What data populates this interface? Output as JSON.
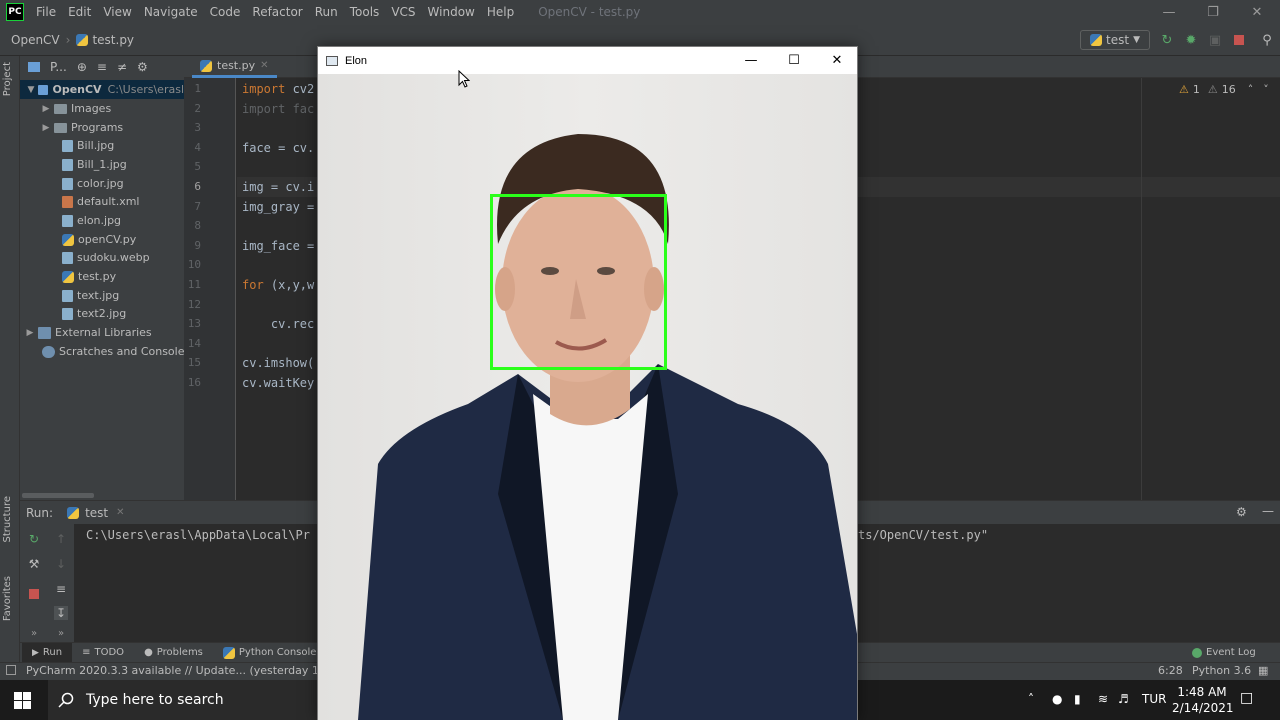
{
  "ide": {
    "app_logo": "PC",
    "menu": [
      "File",
      "Edit",
      "View",
      "Navigate",
      "Code",
      "Refactor",
      "Run",
      "Tools",
      "VCS",
      "Window",
      "Help"
    ],
    "window_title": "OpenCV - test.py",
    "breadcrumb": {
      "project": "OpenCV",
      "file": "test.py"
    },
    "run_config": "test",
    "sidebar_tabs": {
      "project": "Project",
      "structure": "Structure",
      "favorites": "Favorites"
    },
    "project_panel": {
      "header_label": "P...",
      "root": {
        "name": "OpenCV",
        "path": "C:\\Users\\erasl"
      },
      "items": [
        {
          "label": "Images",
          "kind": "folder"
        },
        {
          "label": "Programs",
          "kind": "folder"
        },
        {
          "label": "Bill.jpg",
          "kind": "image"
        },
        {
          "label": "Bill_1.jpg",
          "kind": "image"
        },
        {
          "label": "color.jpg",
          "kind": "image"
        },
        {
          "label": "default.xml",
          "kind": "xml"
        },
        {
          "label": "elon.jpg",
          "kind": "image"
        },
        {
          "label": "openCV.py",
          "kind": "python"
        },
        {
          "label": "sudoku.webp",
          "kind": "image"
        },
        {
          "label": "test.py",
          "kind": "python"
        },
        {
          "label": "text.jpg",
          "kind": "image"
        },
        {
          "label": "text2.jpg",
          "kind": "image"
        }
      ],
      "external_libraries": "External Libraries",
      "scratches": "Scratches and Consoles"
    },
    "editor": {
      "tab": "test.py",
      "line_numbers": [
        "1",
        "2",
        "3",
        "4",
        "5",
        "6",
        "7",
        "8",
        "9",
        "10",
        "11",
        "12",
        "13",
        "14",
        "15",
        "16"
      ],
      "lines": {
        "l1_kw": "import",
        "l1_rest": " cv2",
        "l2_kw": "import",
        "l2_rest": " fac",
        "l4": "face = cv.",
        "l6": "img = cv.i",
        "l7": "img_gray =",
        "l9": "img_face =",
        "l11_kw": "for",
        "l11_rest": " (x,y,w",
        "l13": "    cv.rec",
        "l15": "cv.imshow(",
        "l16": "cv.waitKey"
      },
      "warnings": "1",
      "weak_warnings": "16"
    },
    "run_panel": {
      "label": "Run:",
      "tab": "test",
      "console_start": "C:\\Users\\erasl\\AppData\\Local\\Pr",
      "console_end": "ts/OpenCV/test.py\""
    },
    "tool_tabs": [
      "Run",
      "TODO",
      "Problems",
      "Python Console"
    ],
    "event_log": "Event Log",
    "status": {
      "message": "PyCharm 2020.3.3 available // Update... (yesterday 10:44",
      "caret": "6:28",
      "interpreter": "Python 3.6"
    }
  },
  "cv_window": {
    "title": "Elon",
    "face_box_color": "#2bff1a"
  },
  "taskbar": {
    "search_placeholder": "Type here to search",
    "language": "TUR",
    "time": "1:48 AM",
    "date": "2/14/2021"
  },
  "colors": {
    "ide_bg": "#2b2b2b",
    "panel_bg": "#3c3f41",
    "keyword": "#cc7832",
    "selection": "#0d293e",
    "run_green": "#59a869",
    "stop_red": "#c75450"
  }
}
